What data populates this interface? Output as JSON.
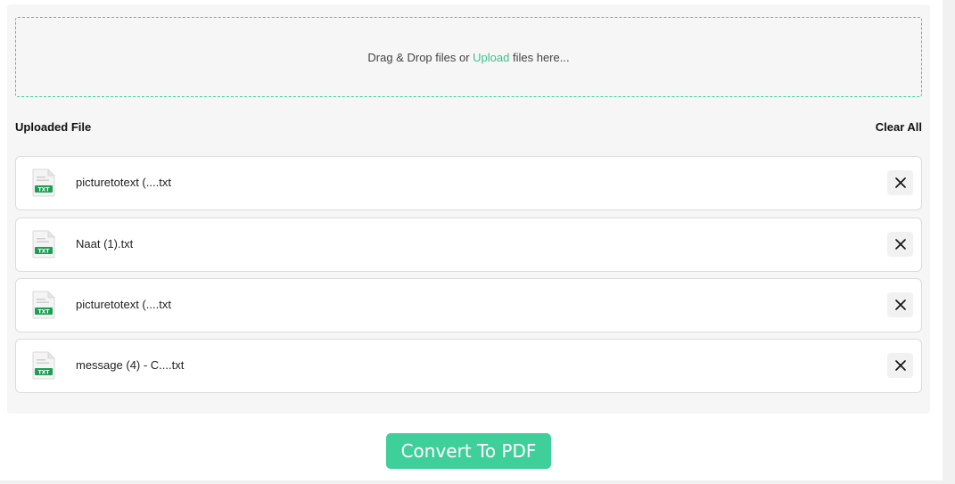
{
  "dropzone": {
    "text_before": "Drag & Drop files or ",
    "link_text": "Upload",
    "text_after": " files here..."
  },
  "list": {
    "title": "Uploaded File",
    "clear_label": "Clear All",
    "files": [
      {
        "name": "picturetotext (....txt",
        "icon": "txt-file-icon",
        "badge": "TXT"
      },
      {
        "name": "Naat (1).txt",
        "icon": "txt-file-icon",
        "badge": "TXT"
      },
      {
        "name": "picturetotext (....txt",
        "icon": "txt-file-icon",
        "badge": "TXT"
      },
      {
        "name": "message (4) - C....txt",
        "icon": "txt-file-icon",
        "badge": "TXT"
      }
    ],
    "remove_icon": "close-icon"
  },
  "convert_label": "Convert To PDF",
  "colors": {
    "accent": "#3ecf9a",
    "link": "#3fbf8b",
    "panel": "#f6f6f6",
    "txt_badge": "#1f9d55"
  }
}
